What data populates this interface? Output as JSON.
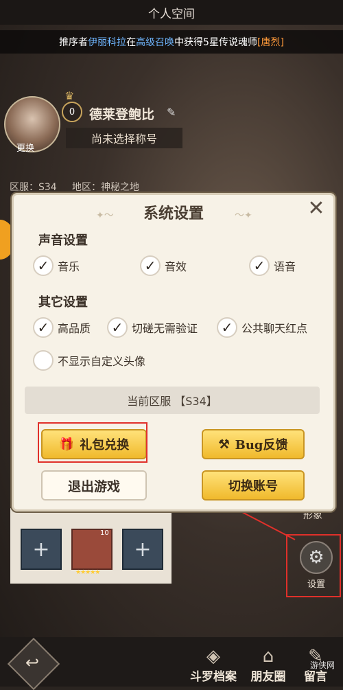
{
  "header": {
    "title": "个人空间"
  },
  "announcement": {
    "prefix": "推序者",
    "player": "伊丽科拉",
    "mid1": "在",
    "event": "高级召唤",
    "mid2": "中获得5星传说魂师",
    "reward": "[唐烈]"
  },
  "profile": {
    "level": "0",
    "name": "德莱登鲍比",
    "change_label": "更换",
    "title_placeholder": "尚未选择称号",
    "server_label": "区服：S34",
    "region_label": "地区：神秘之地"
  },
  "settings_dialog": {
    "title": "系统设置",
    "close_icon": "close-icon",
    "sound_section": "声音设置",
    "sound_options": [
      {
        "label": "音乐",
        "checked": true
      },
      {
        "label": "音效",
        "checked": true
      },
      {
        "label": "语音",
        "checked": true
      }
    ],
    "other_section": "其它设置",
    "other_options": [
      {
        "label": "高品质",
        "checked": true
      },
      {
        "label": "切磋无需验证",
        "checked": true
      },
      {
        "label": "公共聊天红点",
        "checked": true
      },
      {
        "label": "不显示自定义头像",
        "checked": false
      }
    ],
    "current_server": "当前区服 【S34】",
    "buttons": {
      "gift_redeem": "礼包兑换",
      "bug_feedback": "Bug反馈",
      "quit_game": "退出游戏",
      "switch_account": "切换账号"
    }
  },
  "side": {
    "skin_label": "形象",
    "settings_label": "设置"
  },
  "slots": {
    "hero_level": "10"
  },
  "bottom_nav": {
    "items": [
      {
        "label": "斗罗档案"
      },
      {
        "label": "朋友圈"
      },
      {
        "label": "留言"
      }
    ]
  },
  "watermark": "游侠网",
  "colors": {
    "accent_gold": "#f0b92c",
    "highlight_red": "#e0302a",
    "panel_bg": "#f7f2e7"
  }
}
